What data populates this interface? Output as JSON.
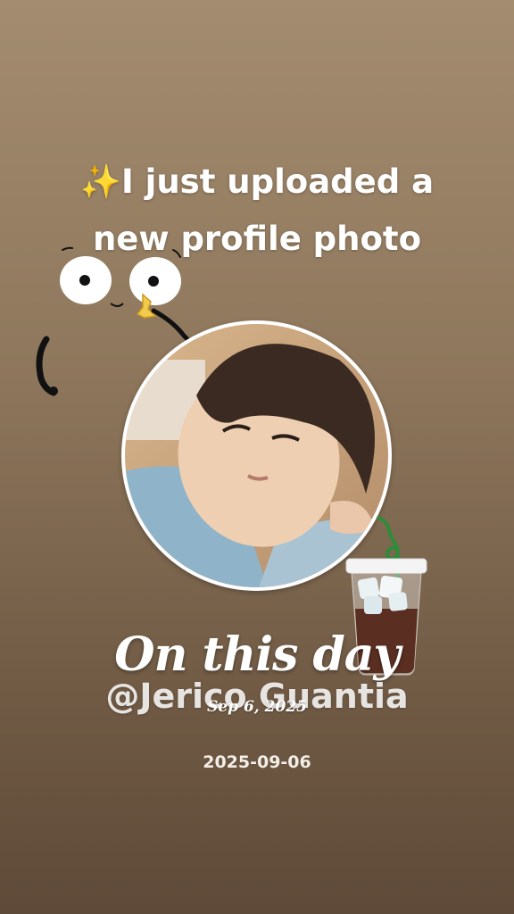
{
  "story": {
    "headline_line1": "I just uploaded a",
    "headline_line2": "new profile photo",
    "sparkle_glyph": "✨",
    "memory_label": "On this day",
    "username": "@Jerico Guantia",
    "date_short": "Sep 6, 2025",
    "date_iso": "2025-09-06"
  },
  "icons": {
    "sparkle": "sparkle-icon",
    "eyes_sticker": "cartoon-eyes-sticker",
    "drink_sticker": "iced-coffee-sticker"
  },
  "colors": {
    "background_top": "#a38c6f",
    "background_bottom": "#5e4a38",
    "text": "#ffffff",
    "sparkle": "#f5c542"
  }
}
